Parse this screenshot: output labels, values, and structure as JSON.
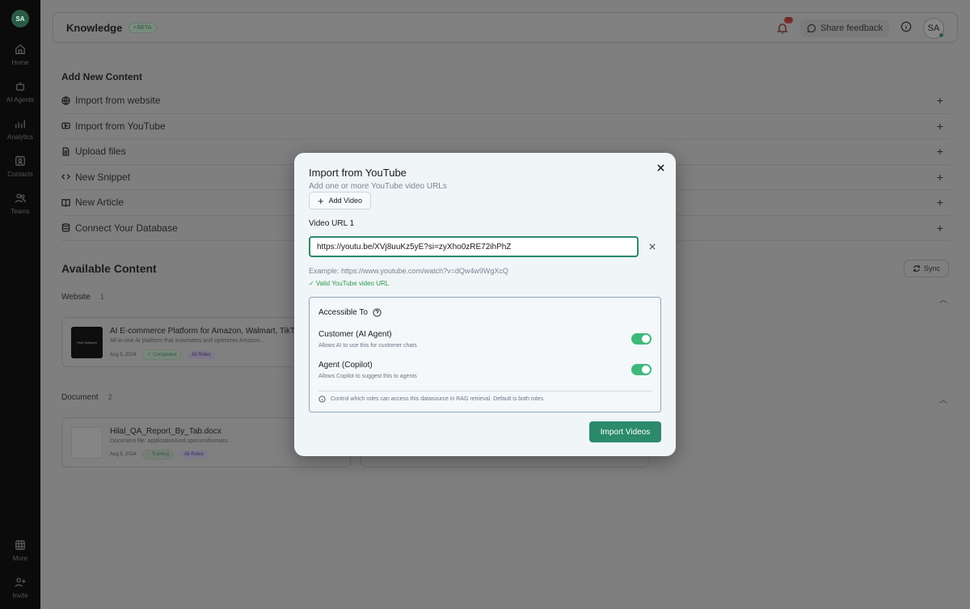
{
  "sidebar": {
    "logo": "SA",
    "items": [
      {
        "label": "Home",
        "icon": "home-icon"
      },
      {
        "label": "AI Agents",
        "icon": "robot-icon"
      },
      {
        "label": "Analytics",
        "icon": "analytics-icon"
      },
      {
        "label": "Contacts",
        "icon": "contacts-icon"
      },
      {
        "label": "Teams",
        "icon": "teams-icon"
      }
    ],
    "bottom_items": [
      {
        "label": "More",
        "icon": "grid-icon"
      },
      {
        "label": "Invite",
        "icon": "invite-icon"
      }
    ]
  },
  "header": {
    "title": "Knowledge",
    "beta": "BETA",
    "notification_count": "23",
    "feedback_label": "Share feedback",
    "avatar": "SA"
  },
  "add_content": {
    "title": "Add New Content",
    "items": [
      {
        "label": "Import from website",
        "icon": "globe-icon"
      },
      {
        "label": "Import from YouTube",
        "icon": "youtube-icon"
      },
      {
        "label": "Upload files",
        "icon": "file-icon"
      },
      {
        "label": "New Snippet",
        "icon": "code-icon"
      },
      {
        "label": "New Article",
        "icon": "book-icon"
      },
      {
        "label": "Connect Your Database",
        "icon": "database-icon"
      }
    ]
  },
  "available": {
    "title": "Available Content",
    "sync_label": "Sync",
    "website": {
      "label": "Website",
      "count": "1",
      "card": {
        "title": "AI E-commerce Platform for Amazon, Walmart, TikTok",
        "subtitle": "All-in-one AI platform that automates and optimizes Amazon...",
        "date": "Aug 5, 2024",
        "status": "Completed",
        "roles": "All Roles",
        "thumb_text": "Hold Software"
      }
    },
    "document": {
      "label": "Document",
      "count": "2",
      "card": {
        "title": "Hilal_QA_Report_By_Tab.docx",
        "subtitle": "Document file: application/vnd.openxmlformats-...",
        "date": "Aug 5, 2024",
        "status": "Training",
        "roles": "All Roles"
      }
    }
  },
  "modal": {
    "title": "Import from YouTube",
    "subtitle": "Add one or more YouTube video URLs",
    "add_video_label": "Add Video",
    "url_label": "Video URL 1",
    "url_value": "https://youtu.be/XVj8uuKz5yE?si=zyXho0zRE72ihPhZ",
    "example": "Example: https://www.youtube.com/watch?v=dQw4w9WgXcQ",
    "valid_msg": "✓ Valid YouTube video URL",
    "access": {
      "title": "Accessible To",
      "roles": [
        {
          "name": "Customer (AI Agent)",
          "desc": "Allows AI to use this for customer chats",
          "enabled": true
        },
        {
          "name": "Agent (Copilot)",
          "desc": "Allows Copilot to suggest this to agents",
          "enabled": true
        }
      ],
      "note": "Control which roles can access this datasource in RAG retrieval. Default is both roles."
    },
    "import_label": "Import Videos"
  },
  "colors": {
    "accent": "#2b8a6a",
    "toggle_on": "#3fb97a",
    "valid_text": "#2e9a4a"
  }
}
